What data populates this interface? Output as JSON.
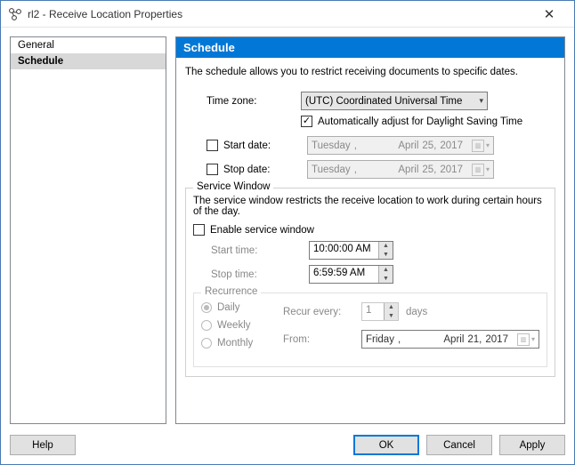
{
  "window": {
    "title": "rl2 - Receive Location Properties"
  },
  "sidebar": {
    "items": [
      "General",
      "Schedule"
    ],
    "selected": 1
  },
  "panel": {
    "header": "Schedule",
    "description": "The schedule allows you to restrict receiving documents to specific dates.",
    "timezone": {
      "label": "Time zone:",
      "value": "(UTC) Coordinated Universal Time",
      "dst_checked": true,
      "dst_label": "Automatically adjust for Daylight Saving Time"
    },
    "start": {
      "checked": false,
      "label": "Start date:",
      "weekday": "Tuesday",
      "month": "April",
      "day": "25,",
      "year": "2017"
    },
    "stop": {
      "checked": false,
      "label": "Stop date:",
      "weekday": "Tuesday",
      "month": "April",
      "day": "25,",
      "year": "2017"
    },
    "service": {
      "legend": "Service Window",
      "desc": "The service window restricts the receive location to work during certain hours of the day.",
      "enable": {
        "checked": false,
        "label": "Enable service window"
      },
      "start_time": {
        "label": "Start time:",
        "value": "10:00:00 AM"
      },
      "stop_time": {
        "label": "Stop time:",
        "value": "6:59:59 AM"
      },
      "recurrence": {
        "legend": "Recurrence",
        "daily": "Daily",
        "weekly": "Weekly",
        "monthly": "Monthly",
        "recur_label": "Recur every:",
        "recur_value": "1",
        "recur_unit": "days",
        "from_label": "From:",
        "from": {
          "weekday": "Friday",
          "month": "April",
          "day": "21,",
          "year": "2017"
        }
      }
    }
  },
  "buttons": {
    "help": "Help",
    "ok": "OK",
    "cancel": "Cancel",
    "apply": "Apply"
  }
}
